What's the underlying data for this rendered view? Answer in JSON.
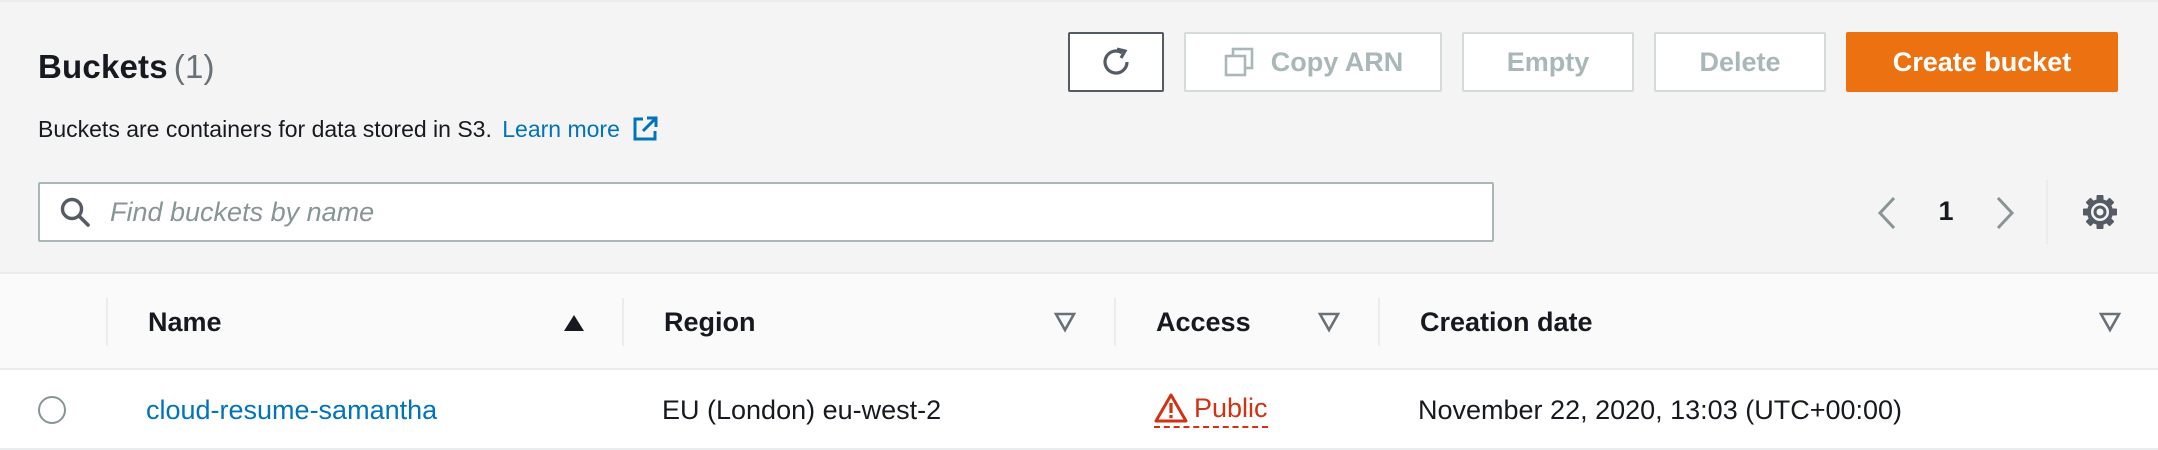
{
  "header": {
    "title": "Buckets",
    "count": "(1)",
    "description": "Buckets are containers for data stored in S3.",
    "learn_more": "Learn more"
  },
  "toolbar": {
    "copy_arn_label": "Copy ARN",
    "empty_label": "Empty",
    "delete_label": "Delete",
    "create_label": "Create bucket"
  },
  "search": {
    "placeholder": "Find buckets by name",
    "value": ""
  },
  "pagination": {
    "current_page": "1"
  },
  "table": {
    "columns": {
      "name": "Name",
      "region": "Region",
      "access": "Access",
      "creation_date": "Creation date"
    },
    "rows": [
      {
        "name": "cloud-resume-samantha",
        "region": "EU (London) eu-west-2",
        "access": "Public",
        "creation_date": "November 22, 2020, 13:03 (UTC+00:00)"
      }
    ]
  },
  "colors": {
    "accent": "#0073bb",
    "primary_button": "#ec7211",
    "public_warning": "#d13212"
  }
}
